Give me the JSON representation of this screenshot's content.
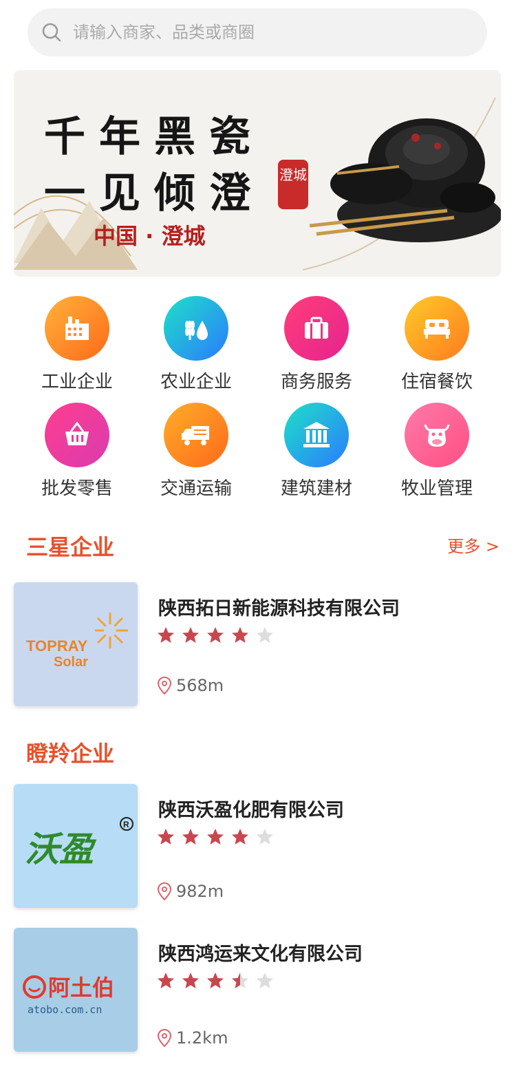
{
  "search": {
    "placeholder": "请输入商家、品类或商圈",
    "icon": "search-icon"
  },
  "banner": {
    "line1": "千年黑瓷",
    "line2": "一见倾澄",
    "seal": "澄城",
    "location": "中国 · 澄城"
  },
  "categories": [
    {
      "label": "工业企业",
      "icon": "factory-icon",
      "color_from": "#ffb23a",
      "color_to": "#ff6a1a"
    },
    {
      "label": "农业企业",
      "icon": "wheat-drop-icon",
      "color_from": "#1ee0c7",
      "color_to": "#2b7bff"
    },
    {
      "label": "商务服务",
      "icon": "briefcase-icon",
      "color_from": "#ff3e7a",
      "color_to": "#e6238f"
    },
    {
      "label": "住宿餐饮",
      "icon": "bed-icon",
      "color_from": "#ffca2a",
      "color_to": "#ff7b1e"
    },
    {
      "label": "批发零售",
      "icon": "basket-icon",
      "color_from": "#ff3e8e",
      "color_to": "#d93bb0"
    },
    {
      "label": "交通运输",
      "icon": "truck-icon",
      "color_from": "#ffad2a",
      "color_to": "#ff6a1a"
    },
    {
      "label": "建筑建材",
      "icon": "bank-building-icon",
      "color_from": "#1ee0c7",
      "color_to": "#2b7bff"
    },
    {
      "label": "牧业管理",
      "icon": "cow-icon",
      "color_from": "#ff7aa8",
      "color_to": "#ff4f84"
    }
  ],
  "sections": {
    "three_star": {
      "title": "三星企业",
      "more": "更多 >"
    },
    "leading": {
      "title": "瞪羚企业"
    }
  },
  "companies": [
    {
      "name": "陕西拓日新能源科技有限公司",
      "rating": 4,
      "distance": "568m",
      "logo_text_1": "TOPRAY",
      "logo_text_2": "Solar"
    },
    {
      "name": "陕西沃盈化肥有限公司",
      "rating": 4,
      "distance": "982m",
      "logo_text_1": "沃盈"
    },
    {
      "name": "陕西鸿运来文化有限公司",
      "rating": 3.5,
      "distance": "1.2km",
      "logo_text_1": "阿土伯",
      "logo_text_2": "atobo.com.cn"
    }
  ],
  "colors": {
    "accent": "#e8512b",
    "star_on": "#c8474f",
    "star_off": "#dddddd"
  }
}
